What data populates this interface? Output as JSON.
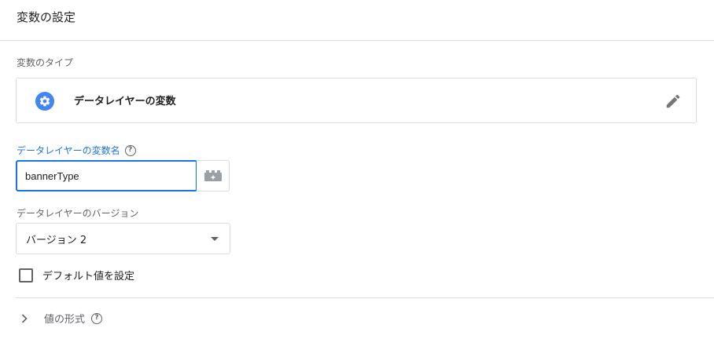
{
  "header": {
    "title": "変数の設定"
  },
  "variable_type": {
    "section_label": "変数のタイプ",
    "name": "データレイヤーの変数",
    "icon": "gear-icon",
    "accent_color": "#4285f4"
  },
  "data_layer_name": {
    "label": "データレイヤーの変数名",
    "value": "bannerType"
  },
  "data_layer_version": {
    "label": "データレイヤーのバージョン",
    "selected": "バージョン 2"
  },
  "default_value": {
    "label": "デフォルト値を設定",
    "checked": false
  },
  "value_format": {
    "label": "値の形式"
  }
}
